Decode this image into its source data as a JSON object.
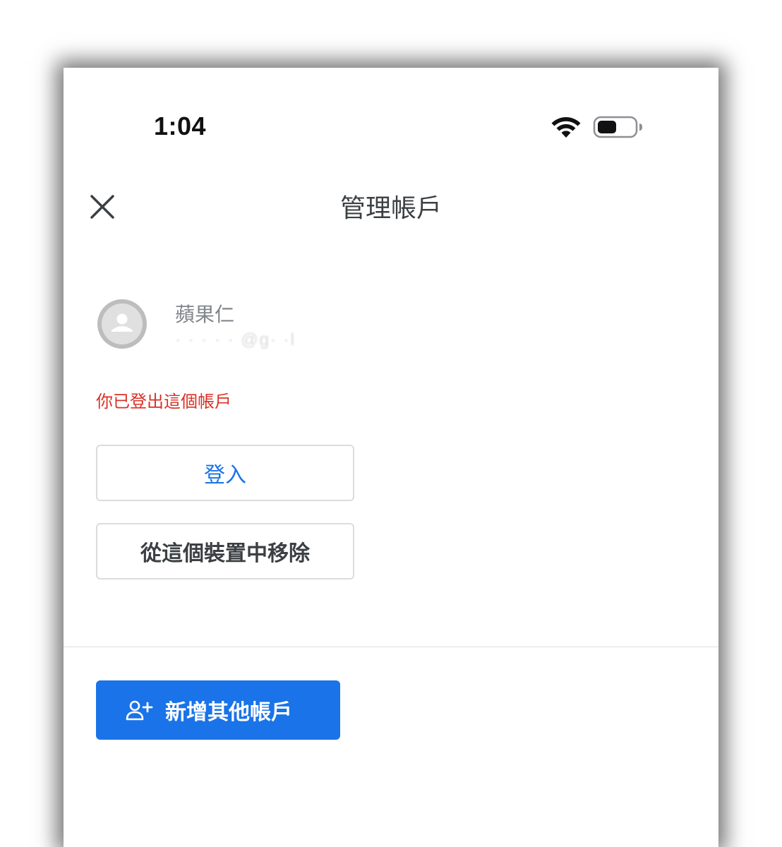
{
  "status_bar": {
    "time": "1:04",
    "icons": [
      "wifi-icon",
      "battery-icon"
    ]
  },
  "header": {
    "close_icon": "close-icon",
    "title": "管理帳戶"
  },
  "account": {
    "name": "蘋果仁",
    "email": "· · ·  ·  · @g· ·l",
    "avatar_icon": "avatar-icon",
    "signed_out_message": "你已登出這個帳戶"
  },
  "actions": {
    "sign_in_label": "登入",
    "remove_label": "從這個裝置中移除",
    "add_account_label": "新增其他帳戶",
    "add_account_icon": "person-add-icon"
  },
  "colors": {
    "primary": "#1a73e8",
    "error": "#d93025",
    "text": "#3c4043",
    "muted": "#80868b",
    "border": "#dadce0"
  }
}
